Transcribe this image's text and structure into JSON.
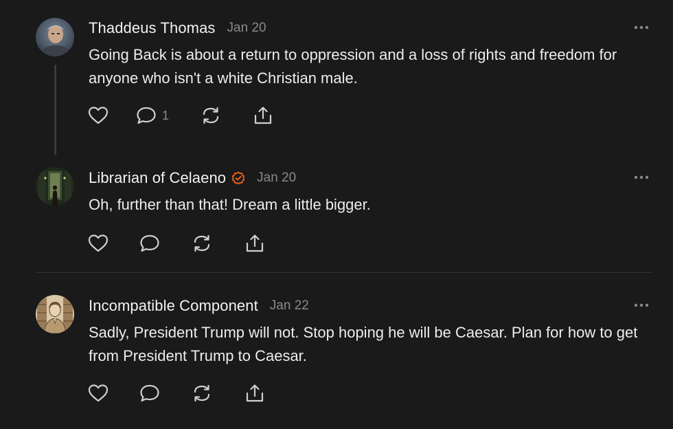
{
  "comments": [
    {
      "author": "Thaddeus Thomas",
      "date": "Jan 20",
      "text": "Going Back is about a return to oppression and a loss of rights and freedom for anyone who isn't a white Christian male.",
      "reply_count": "1",
      "verified": false
    },
    {
      "author": "Librarian of Celaeno",
      "date": "Jan 20",
      "text": "Oh, further than that! Dream a little bigger.",
      "verified": true
    },
    {
      "author": "Incompatible Component",
      "date": "Jan 22",
      "text": "Sadly, President Trump will not. Stop hoping he will be Caesar. Plan for how to get from President Trump to Caesar.",
      "verified": false
    }
  ],
  "icons": {
    "like": "heart-icon",
    "reply": "comment-bubble-icon",
    "restack": "restack-icon",
    "share": "share-icon",
    "more": "more-options-icon",
    "verified": "verified-check-icon"
  },
  "colors": {
    "background": "#1a1a1b",
    "accent": "#ff6719",
    "muted": "#8a8a8e",
    "text": "#ededed"
  }
}
